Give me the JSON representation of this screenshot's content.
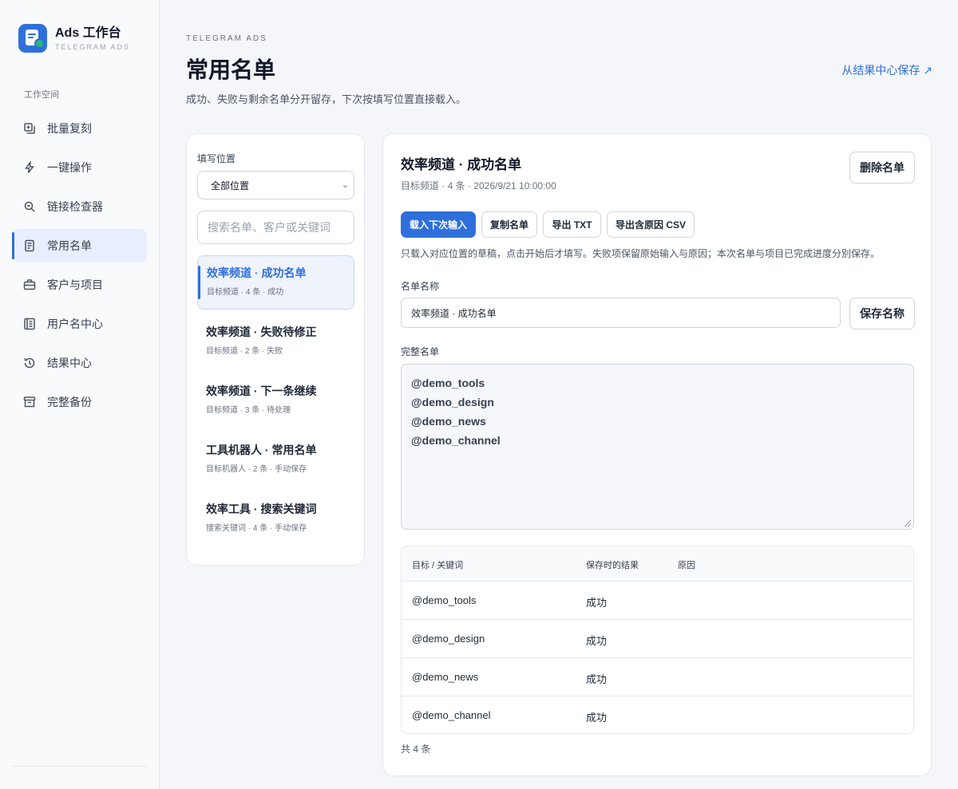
{
  "brand": {
    "title": "Ads 工作台",
    "subtitle": "TELEGRAM ADS"
  },
  "sidebar": {
    "section_label": "工作空间",
    "items": [
      {
        "label": "批量复刻",
        "icon": "copy-plus-icon"
      },
      {
        "label": "一键操作",
        "icon": "lightning-icon"
      },
      {
        "label": "链接检查器",
        "icon": "search-zoom-icon"
      },
      {
        "label": "常用名单",
        "icon": "document-icon",
        "active": true
      },
      {
        "label": "客户与项目",
        "icon": "briefcase-icon"
      },
      {
        "label": "用户名中心",
        "icon": "address-book-icon"
      },
      {
        "label": "结果中心",
        "icon": "history-icon"
      },
      {
        "label": "完整备份",
        "icon": "archive-icon"
      }
    ]
  },
  "header": {
    "eyebrow": "TELEGRAM ADS",
    "title": "常用名单",
    "description": "成功、失败与剩余名单分开留存，下次按填写位置直接载入。",
    "link": "从结果中心保存 ↗"
  },
  "left_panel": {
    "position_label": "填写位置",
    "position_value": "全部位置",
    "search_placeholder": "搜索名单、客户或关键词",
    "lists": [
      {
        "title": "效率频道 · 成功名单",
        "meta": "目标频道 · 4 条 · 成功",
        "active": true
      },
      {
        "title": "效率频道 · 失败待修正",
        "meta": "目标频道 · 2 条 · 失败"
      },
      {
        "title": "效率频道 · 下一条继续",
        "meta": "目标频道 · 3 条 · 待处理"
      },
      {
        "title": "工具机器人 · 常用名单",
        "meta": "目标机器人 · 2 条 · 手动保存"
      },
      {
        "title": "效率工具 · 搜索关键词",
        "meta": "搜索关键词 · 4 条 · 手动保存"
      }
    ]
  },
  "detail": {
    "title": "效率频道 · 成功名单",
    "meta": "目标频道 · 4 条 · 2026/9/21 10:00:00",
    "delete_label": "删除名单",
    "actions": {
      "load": "载入下次输入",
      "copy": "复制名单",
      "export_txt": "导出 TXT",
      "export_csv": "导出含原因 CSV"
    },
    "note": "只载入对应位置的草稿，点击开始后才填写。失败项保留原始输入与原因；本次名单与项目已完成进度分别保存。",
    "name_label": "名单名称",
    "name_value": "效率频道 · 成功名单",
    "save_name_label": "保存名称",
    "full_list_label": "完整名单",
    "full_list": [
      "@demo_tools",
      "@demo_design",
      "@demo_news",
      "@demo_channel"
    ],
    "table": {
      "headers": [
        "目标 / 关键词",
        "保存时的结果",
        "原因"
      ],
      "rows": [
        {
          "target": "@demo_tools",
          "result": "成功",
          "reason": ""
        },
        {
          "target": "@demo_design",
          "result": "成功",
          "reason": ""
        },
        {
          "target": "@demo_news",
          "result": "成功",
          "reason": ""
        },
        {
          "target": "@demo_channel",
          "result": "成功",
          "reason": ""
        }
      ]
    },
    "footer": "共 4 条"
  }
}
